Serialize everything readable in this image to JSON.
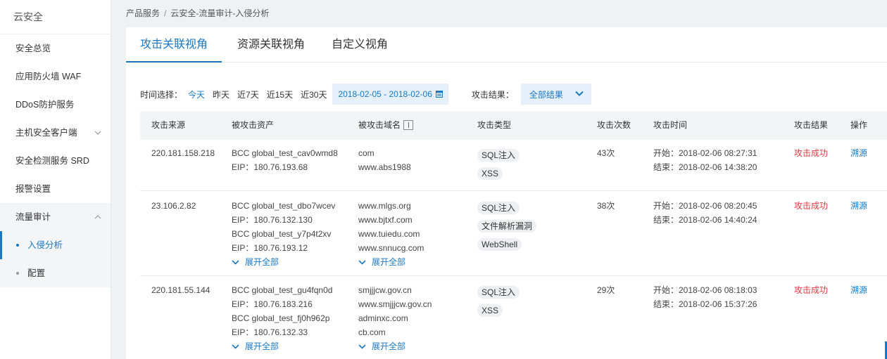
{
  "sidebar": {
    "title": "云安全",
    "items": [
      {
        "label": "安全总览"
      },
      {
        "label": "应用防火墙 WAF"
      },
      {
        "label": "DDoS防护服务"
      },
      {
        "label": "主机安全客户端"
      },
      {
        "label": "安全检测服务 SRD"
      },
      {
        "label": "报警设置"
      }
    ],
    "group": {
      "label": "流量审计",
      "children": [
        {
          "label": "入侵分析"
        },
        {
          "label": "配置"
        }
      ]
    }
  },
  "breadcrumb": {
    "root": "产品服务",
    "separator": "/",
    "current": "云安全-流量审计-入侵分析"
  },
  "tabs": [
    {
      "label": "攻击关联视角"
    },
    {
      "label": "资源关联视角"
    },
    {
      "label": "自定义视角"
    }
  ],
  "filter": {
    "time_label": "时间选择：",
    "options": [
      "今天",
      "昨天",
      "近7天",
      "近15天",
      "近30天"
    ],
    "active_option": "今天",
    "date_range": "2018-02-05 - 2018-02-06",
    "result_label": "攻击结果：",
    "result_value": "全部结果"
  },
  "table": {
    "headers": [
      "攻击来源",
      "被攻击资产",
      "被攻击域名",
      "攻击类型",
      "攻击次数",
      "攻击时间",
      "攻击结果",
      "操作"
    ],
    "rows": [
      {
        "source": "220.181.158.218",
        "assets": [
          "BCC global_test_cav0wmd8",
          "EIP：180.76.193.68"
        ],
        "domains": [
          "com",
          "www.abs1988"
        ],
        "types": [
          "SQL注入",
          "XSS"
        ],
        "count": "43次",
        "start": "开始：2018-02-06 08:27:31",
        "end": "结束：2018-02-06 14:38:20",
        "result": "攻击成功",
        "action": "溯源"
      },
      {
        "source": "23.106.2.82",
        "assets": [
          "BCC global_test_dbo7wcev",
          "EIP：180.76.132.130",
          "BCC global_test_y7p4t2xv",
          "EIP：180.76.193.12"
        ],
        "assets_expand": "展开全部",
        "domains": [
          "www.mlgs.org",
          "www.bjtxf.com",
          "www.tuiedu.com",
          "www.snnucg.com"
        ],
        "domains_expand": "展开全部",
        "types": [
          "SQL注入",
          "文件解析漏洞",
          "WebShell"
        ],
        "count": "38次",
        "start": "开始：2018-02-06 08:20:45",
        "end": "结束：2018-02-06 14:40:24",
        "result": "攻击成功",
        "action": "溯源"
      },
      {
        "source": "220.181.55.144",
        "assets": [
          "BCC global_test_gu4fqn0d",
          "EIP：180.76.183.216",
          "BCC global_test_fj0h962p",
          "EIP：180.76.132.33"
        ],
        "assets_expand": "展开全部",
        "domains": [
          "smjjjcw.gov.cn",
          "www.smjjjcw.gov.cn",
          "adminxc.com",
          "cb.com"
        ],
        "domains_expand": "展开全部",
        "types": [
          "SQL注入",
          "XSS"
        ],
        "count": "29次",
        "start": "开始：2018-02-06 08:18:03",
        "end": "结束：2018-02-06 15:37:26",
        "result": "攻击成功",
        "action": "溯源"
      }
    ]
  },
  "colors": {
    "accent": "#1a78c2",
    "danger": "#e0393e",
    "tag_bg": "#eef0f3",
    "header_bg": "#f3f4f6"
  }
}
